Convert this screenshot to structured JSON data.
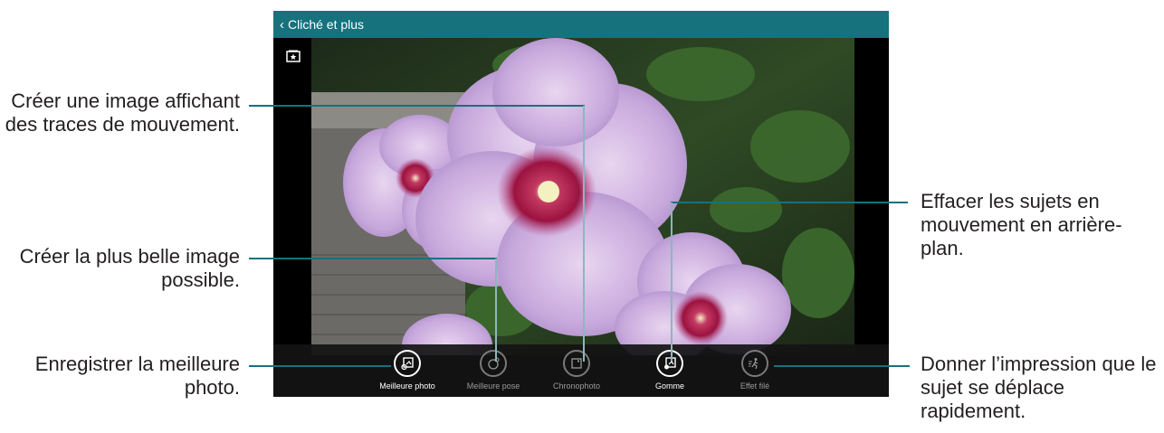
{
  "titlebar": {
    "back_icon": "chevron-left-icon",
    "title": "Cliché et plus"
  },
  "gallery_icon": "gallery-star-icon",
  "modes": [
    {
      "label": "Meilleure photo",
      "icon": "best-photo-icon",
      "state": "active"
    },
    {
      "label": "Meilleure pose",
      "icon": "best-face-icon",
      "state": "dim"
    },
    {
      "label": "Chronophoto",
      "icon": "drama-shot-icon",
      "state": "dim"
    },
    {
      "label": "Gomme",
      "icon": "eraser-icon",
      "state": "active"
    },
    {
      "label": "Effet filé",
      "icon": "panning-shot-icon",
      "state": "dim"
    }
  ],
  "callouts": {
    "chronophoto": "Créer une image affichant des traces de mouvement.",
    "meilleure_pose": "Créer la plus belle image possible.",
    "meilleure_photo": "Enregistrer la meilleure photo.",
    "gomme": "Effacer les sujets en mouvement en arrière-plan.",
    "effet_file": "Donner l’impression que le sujet se déplace rapidement."
  },
  "colors": {
    "titlebar": "#16727d",
    "callout_line": "#16727d",
    "text": "#231f20"
  }
}
